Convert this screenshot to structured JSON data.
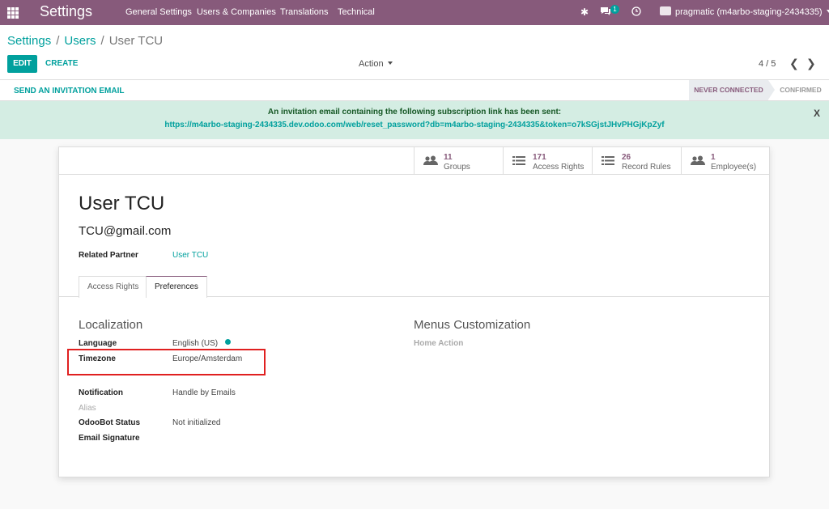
{
  "topbar": {
    "brand": "Settings",
    "menu": [
      "General Settings",
      "Users & Companies",
      "Translations",
      "Technical"
    ],
    "chat_badge": "1",
    "user": "pragmatic (m4arbo-staging-2434335)"
  },
  "breadcrumb": {
    "root": "Settings",
    "parent": "Users",
    "current": "User TCU",
    "separator": "/"
  },
  "buttons": {
    "edit": "EDIT",
    "create": "CREATE",
    "action": "Action"
  },
  "pager": {
    "text": "4 / 5",
    "prev": "❮",
    "next": "❯"
  },
  "statusbar": {
    "invite": "SEND AN INVITATION EMAIL",
    "stages": [
      "NEVER CONNECTED",
      "CONFIRMED"
    ],
    "active_stage": "NEVER CONNECTED"
  },
  "alert": {
    "message": "An invitation email containing the following subscription link has been sent:",
    "link": "https://m4arbo-staging-2434335.dev.odoo.com/web/reset_password?db=m4arbo-staging-2434335&token=o7kSGjstJHvPHGjKpZyf",
    "close": "X"
  },
  "smart_buttons": [
    {
      "count": "11",
      "label": "Groups",
      "icon": "users-icon"
    },
    {
      "count": "171",
      "label": "Access Rights",
      "icon": "list-icon"
    },
    {
      "count": "26",
      "label": "Record Rules",
      "icon": "list-icon"
    },
    {
      "count": "1",
      "label": "Employee(s)",
      "icon": "users-icon"
    }
  ],
  "user": {
    "name": "User TCU",
    "login": "TCU@gmail.com",
    "related_partner_label": "Related Partner",
    "related_partner": "User TCU"
  },
  "tabs": [
    "Access Rights",
    "Preferences"
  ],
  "active_tab": "Preferences",
  "localization": {
    "title": "Localization",
    "language_label": "Language",
    "language": "English (US)",
    "timezone_label": "Timezone",
    "timezone": "Europe/Amsterdam"
  },
  "menus": {
    "title": "Menus Customization",
    "home_action_label": "Home Action"
  },
  "notification": {
    "notification_label": "Notification",
    "notification": "Handle by Emails",
    "alias_label": "Alias",
    "odoobot_label": "OdooBot Status",
    "odoobot": "Not initialized",
    "signature_label": "Email Signature"
  },
  "colors": {
    "brand": "#875a7b",
    "accent": "#00a09d",
    "alert_bg": "#d4ede3",
    "highlight": "#e02020"
  }
}
